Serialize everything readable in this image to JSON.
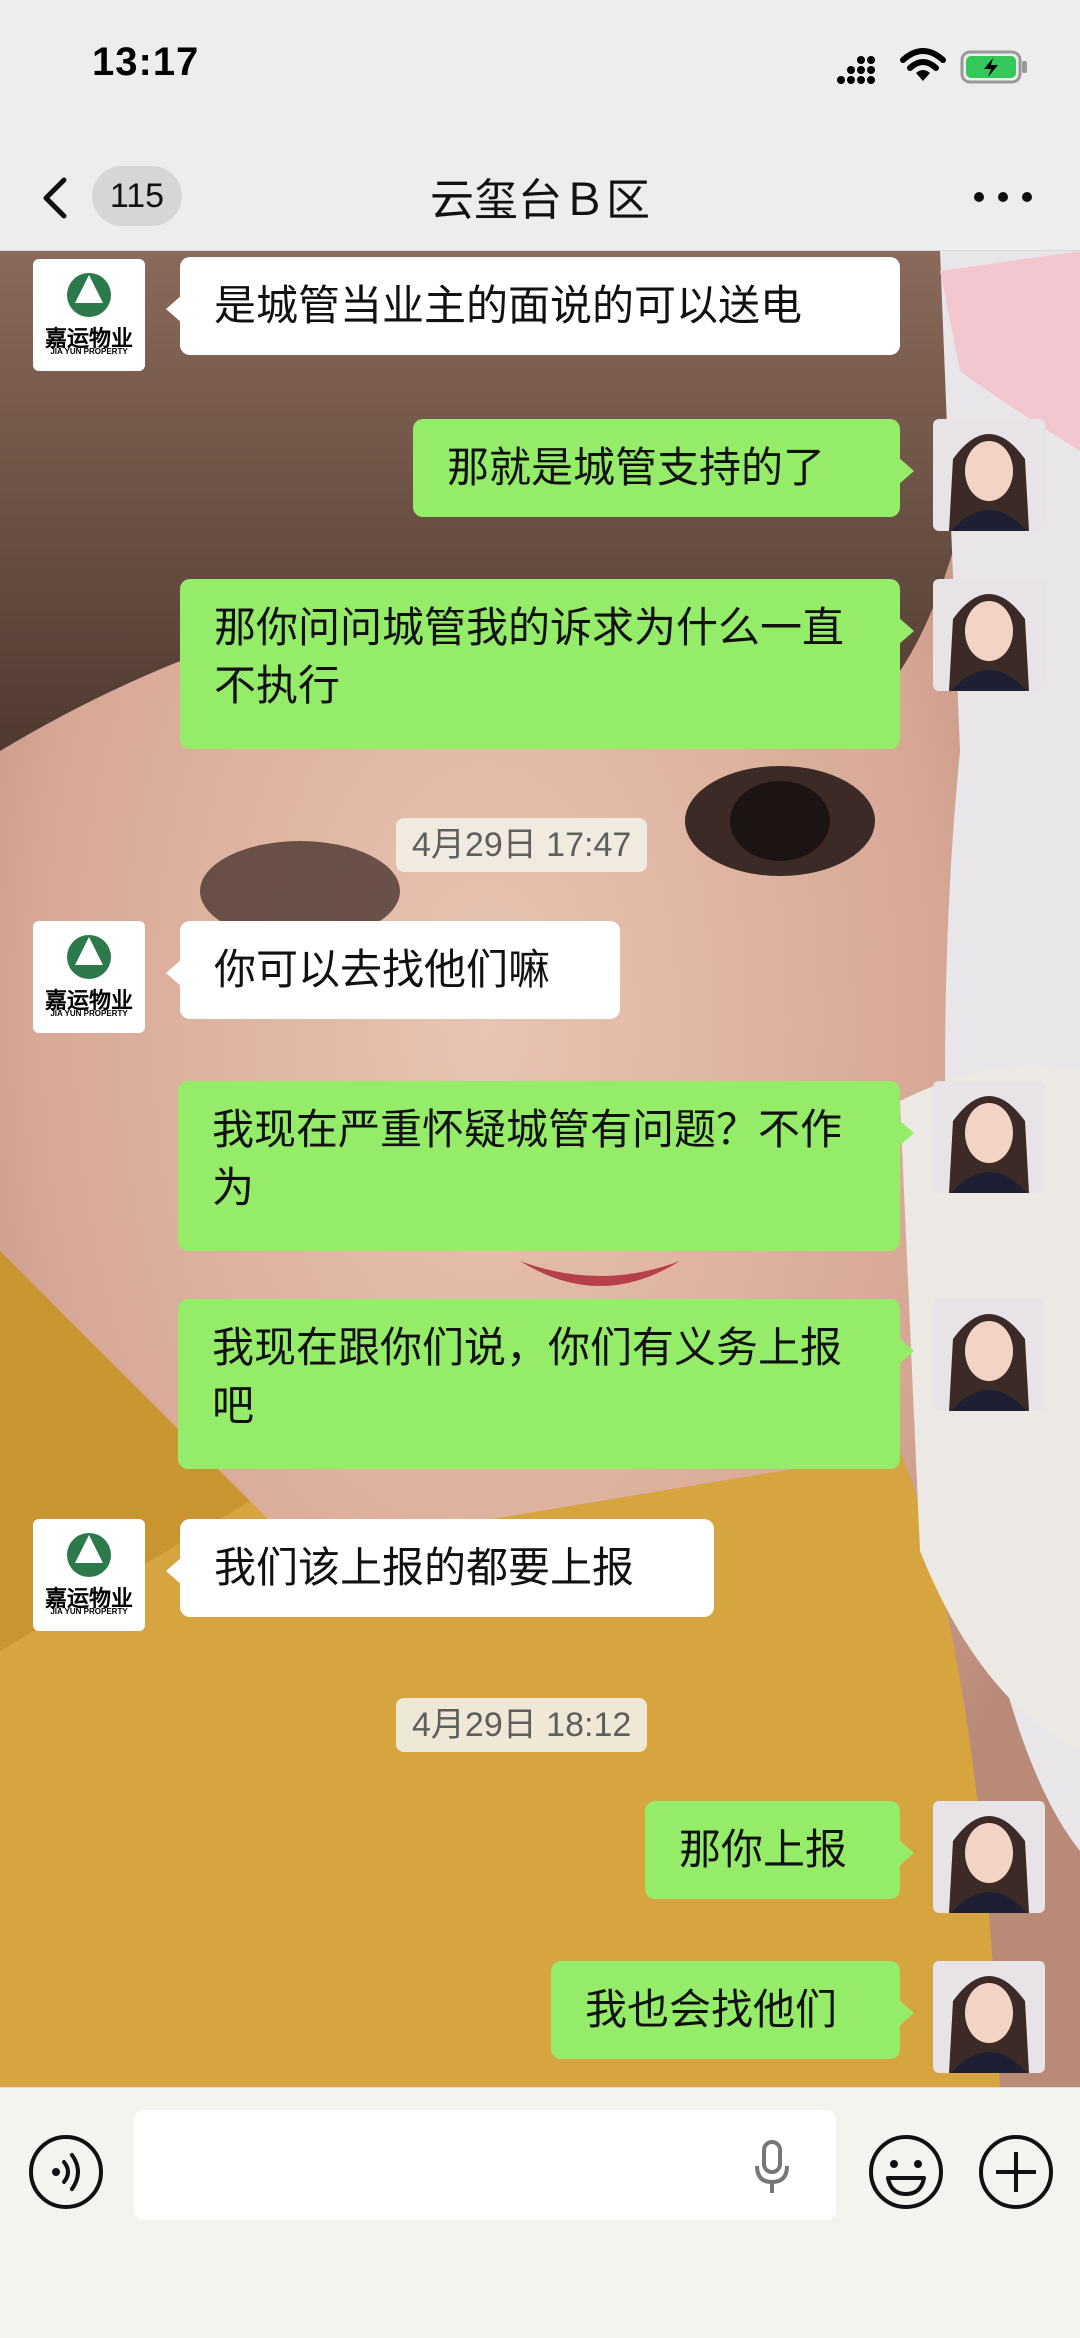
{
  "status_bar": {
    "time": "13:17"
  },
  "nav": {
    "unread_count": "115",
    "title": "云玺台Ｂ区"
  },
  "contact_avatar": {
    "logo_cn": "嘉运物业",
    "logo_en": "JIA YUN PROPERTY",
    "logo_color": "#2c7a4b"
  },
  "messages": [
    {
      "side": "in",
      "text": "是城管当业主的面说的可以送电"
    },
    {
      "side": "out",
      "text": "那就是城管支持的了"
    },
    {
      "side": "out",
      "text": "那你问问城管我的诉求为什么一直不执行"
    },
    {
      "type": "time",
      "text": "4月29日 17:47"
    },
    {
      "side": "in",
      "text": "你可以去找他们嘛"
    },
    {
      "side": "out",
      "text": "我现在严重怀疑城管有问题？不作为"
    },
    {
      "side": "out",
      "text": "我现在跟你们说，你们有义务上报吧"
    },
    {
      "side": "in",
      "text": "我们该上报的都要上报"
    },
    {
      "type": "time",
      "text": "4月29日 18:12"
    },
    {
      "side": "out",
      "text": "那你上报"
    },
    {
      "side": "out",
      "text": "我也会找他们"
    }
  ],
  "colors": {
    "bubble_out": "#95ec69",
    "bubble_in": "#ffffff",
    "chrome": "#ededed"
  },
  "icons": {
    "back": "chevron-left-icon",
    "more": "more-dots-icon",
    "voice": "voice-icon",
    "mic": "mic-icon",
    "emoji": "emoji-icon",
    "plus": "plus-icon"
  }
}
